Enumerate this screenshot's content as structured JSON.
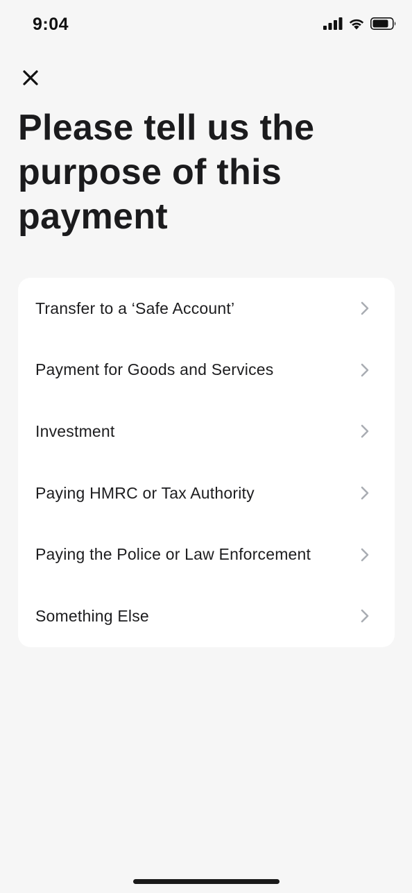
{
  "status_bar": {
    "time": "9:04",
    "icons": [
      "cellular-signal-icon",
      "wifi-icon",
      "battery-icon"
    ]
  },
  "header": {
    "close_icon": "close-icon",
    "title": "Please tell us the purpose of this payment"
  },
  "options": [
    {
      "label": "Transfer to a ‘Safe Account’",
      "icon": "chevron-right-icon"
    },
    {
      "label": "Payment for Goods and Services",
      "icon": "chevron-right-icon"
    },
    {
      "label": "Investment",
      "icon": "chevron-right-icon"
    },
    {
      "label": "Paying HMRC or Tax Authority",
      "icon": "chevron-right-icon"
    },
    {
      "label": "Paying the Police or Law Enforcement",
      "icon": "chevron-right-icon"
    },
    {
      "label": "Something Else",
      "icon": "chevron-right-icon"
    }
  ],
  "colors": {
    "background": "#f6f6f6",
    "card": "#ffffff",
    "text": "#1b1b1d",
    "chevron": "#a9adb3"
  }
}
